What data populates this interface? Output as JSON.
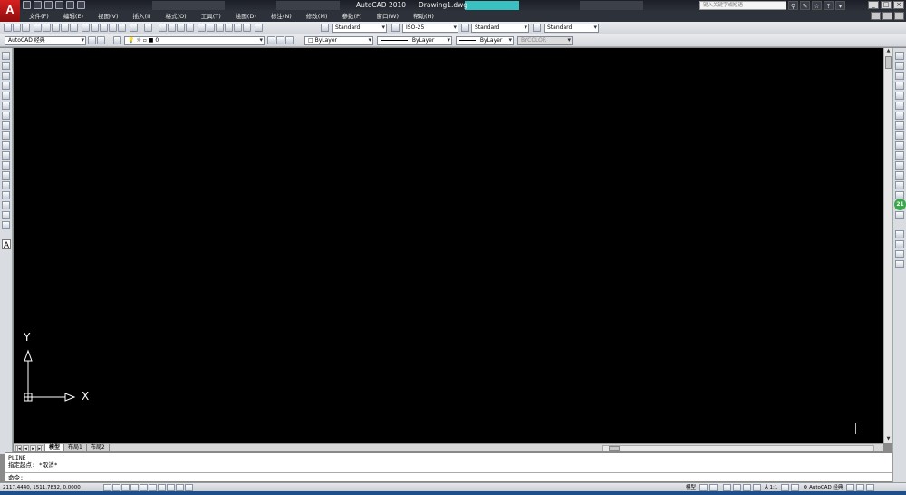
{
  "window": {
    "app_title": "AutoCAD 2010",
    "document_title": "Drawing1.dwg",
    "search_placeholder": "键入关键字或短语"
  },
  "menu": {
    "items": [
      "文件(F)",
      "编辑(E)",
      "视图(V)",
      "插入(I)",
      "格式(O)",
      "工具(T)",
      "绘图(D)",
      "标注(N)",
      "修改(M)",
      "参数(P)",
      "窗口(W)",
      "帮助(H)"
    ]
  },
  "styles_toolbar": {
    "text_style": "Standard",
    "dim_style": "ISO-25",
    "table_style": "Standard",
    "multileader_style": "Standard"
  },
  "layers_toolbar": {
    "workspace": "AutoCAD 经典",
    "current_layer": "0"
  },
  "properties_toolbar": {
    "color": "ByLayer",
    "linetype": "ByLayer",
    "lineweight": "ByLayer",
    "plot_style": "BYCOLOR"
  },
  "ucs": {
    "x_label": "X",
    "y_label": "Y"
  },
  "layout_tabs": {
    "tabs": [
      "模型",
      "布局1",
      "布局2"
    ],
    "active": "模型"
  },
  "command": {
    "history": [
      "PLINE",
      "指定起点: *取消*"
    ],
    "prompt": "命令:"
  },
  "status_bar": {
    "coordinates": "2117.4440, 1511.7832, 0.0000",
    "model_label": "模型",
    "annotation_scale": "1:1",
    "workspace": "AutoCAD 经典"
  },
  "badge": {
    "value": "21",
    "color": "#3aa84a"
  },
  "colors": {
    "canvas": "#000000",
    "titlebar": "#1c1f27",
    "menubar": "#2d3139",
    "ucs": "#ffffff"
  }
}
